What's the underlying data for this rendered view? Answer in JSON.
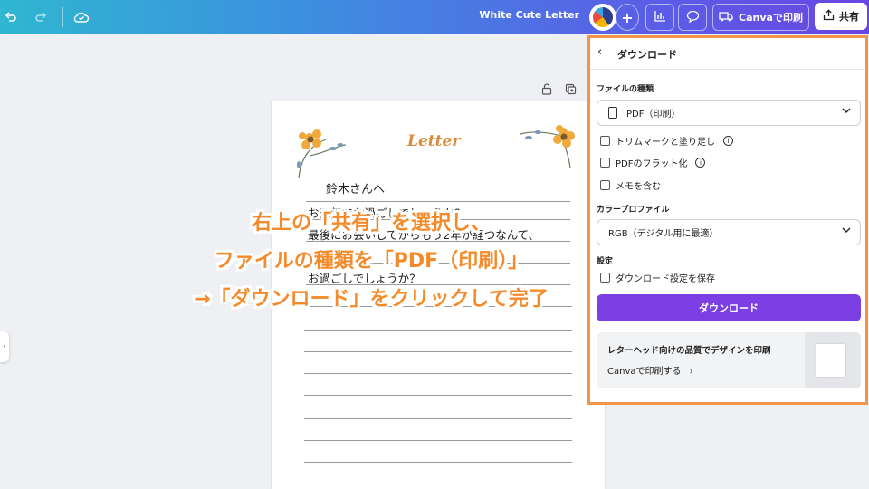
{
  "topbar": {
    "doc_title": "White Cute Letter",
    "print_label": "Canvaで印刷",
    "share_label": "共有",
    "add_label": "+"
  },
  "letter": {
    "title": "Letter",
    "salutation": "鈴木さんへ",
    "lines": [
      "お元気でお過ごしでしょうか？",
      "最後にお会いしてからもう2年が経つなんて、",
      "早いですね。",
      "お過ごしでしょうか？"
    ]
  },
  "caption": {
    "line1": "右上の「共有」を選択し、",
    "line2": "ファイルの種類を「PDF（印刷）」",
    "line3": "→「ダウンロード」をクリックして完了"
  },
  "panel": {
    "title": "ダウンロード",
    "file_type_label": "ファイルの種類",
    "file_type_value": "PDF（印刷）",
    "options": {
      "trim": "トリムマークと塗り足し",
      "flatten": "PDFのフラット化",
      "notes": "メモを含む"
    },
    "color_profile_label": "カラープロファイル",
    "color_profile_value": "RGB（デジタル用に最適）",
    "settings_label": "設定",
    "save_settings": "ダウンロード設定を保存",
    "download_button": "ダウンロード",
    "promo": {
      "title": "レターヘッド向けの品質でデザインを印刷",
      "link": "Canvaで印刷する"
    }
  },
  "colors": {
    "accent": "#7b3fe4",
    "caption": "#f58a2a",
    "highlight_border": "#f2954b"
  }
}
